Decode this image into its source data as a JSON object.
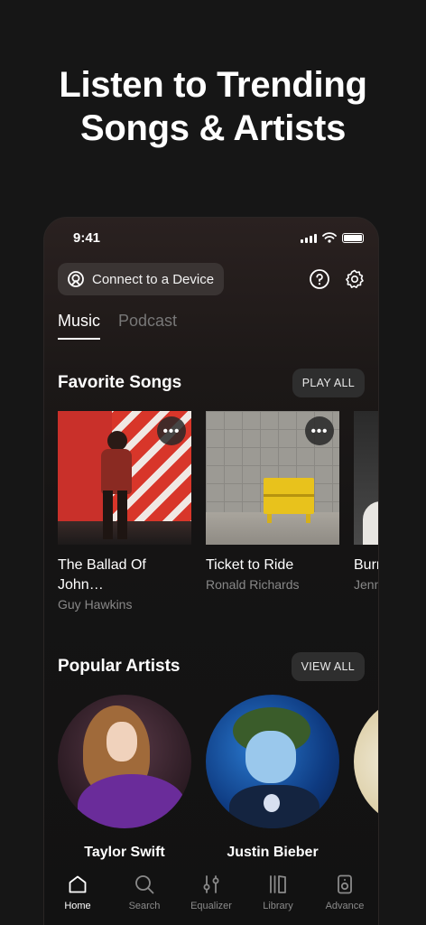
{
  "headline": {
    "line1": "Listen to Trending",
    "line2": "Songs & Artists"
  },
  "status_bar": {
    "time": "9:41"
  },
  "header": {
    "connect_label": "Connect to a Device"
  },
  "tabs": [
    {
      "label": "Music"
    },
    {
      "label": "Podcast"
    }
  ],
  "favorite_songs": {
    "title": "Favorite Songs",
    "action": "PLAY ALL",
    "items": [
      {
        "title": "The Ballad Of John…",
        "artist": "Guy Hawkins"
      },
      {
        "title": "Ticket to Ride",
        "artist": "Ronald Richards"
      },
      {
        "title": "Burn the…",
        "artist": "Jenny"
      }
    ]
  },
  "popular_artists": {
    "title": "Popular Artists",
    "action": "VIEW ALL",
    "items": [
      {
        "name": "Taylor Swift"
      },
      {
        "name": "Justin Bieber"
      },
      {
        "name": ""
      }
    ]
  },
  "bottom_nav": [
    {
      "label": "Home",
      "icon": "home-icon"
    },
    {
      "label": "Search",
      "icon": "search-icon"
    },
    {
      "label": "Equalizer",
      "icon": "equalizer-icon"
    },
    {
      "label": "Library",
      "icon": "library-icon"
    },
    {
      "label": "Advance",
      "icon": "speaker-icon"
    }
  ],
  "colors": {
    "background": "#161616",
    "pill": "#2e2e2e",
    "muted": "#888888"
  }
}
